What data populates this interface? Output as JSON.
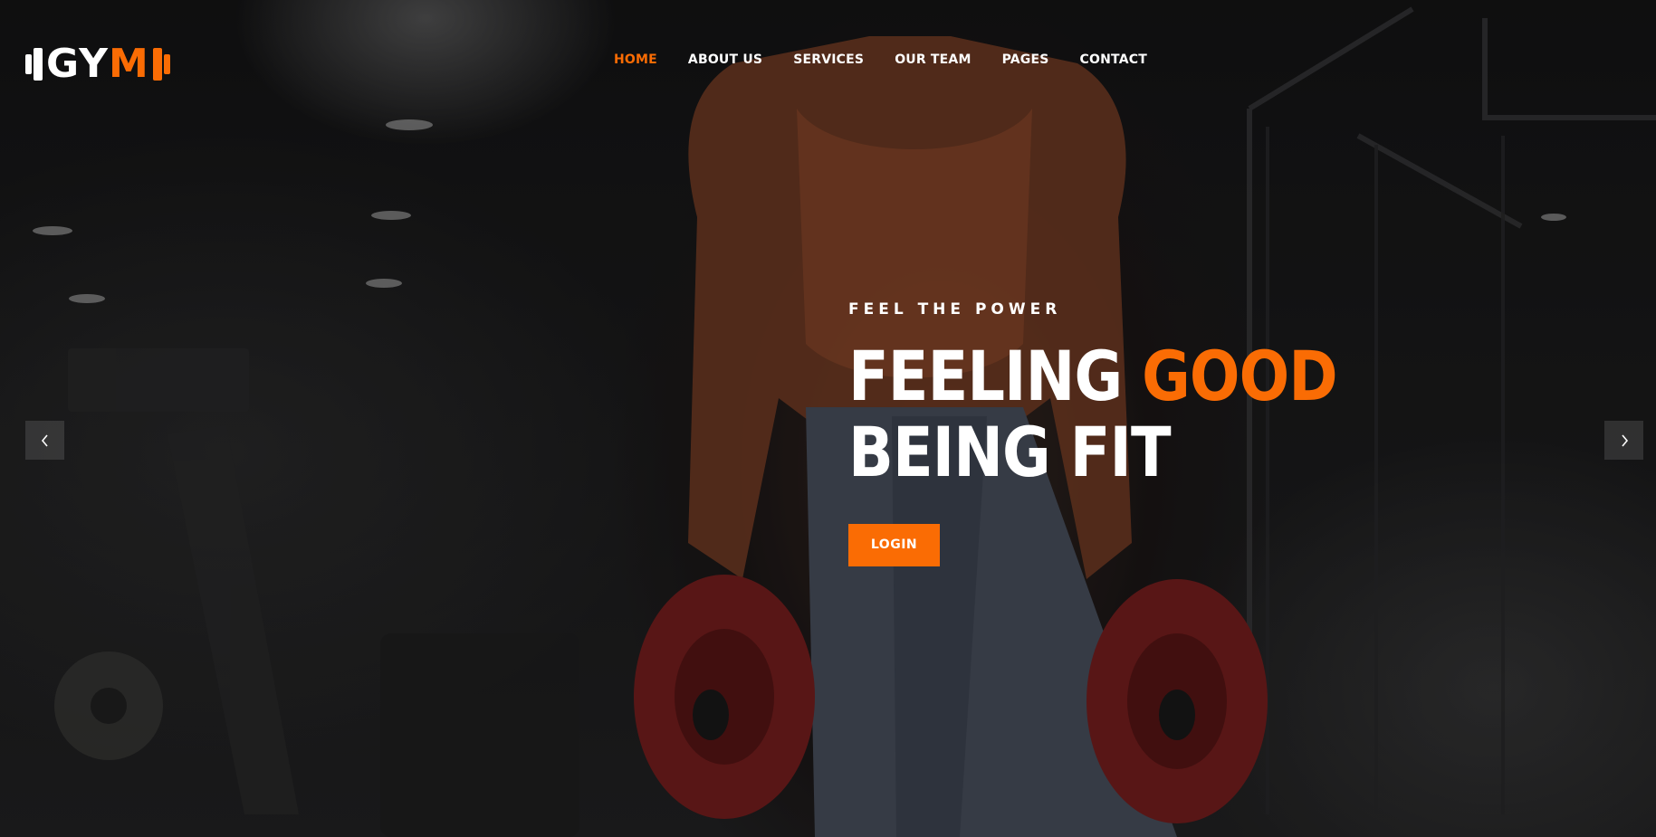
{
  "brand": {
    "logo_left": "G",
    "logo_right": "M",
    "accent_color": "#fa6c04"
  },
  "nav": {
    "items": [
      {
        "label": "HOME",
        "active": true
      },
      {
        "label": "ABOUT US",
        "active": false
      },
      {
        "label": "SERVICES",
        "active": false
      },
      {
        "label": "OUR TEAM",
        "active": false
      },
      {
        "label": "PAGES",
        "active": false
      },
      {
        "label": "CONTACT",
        "active": false
      }
    ]
  },
  "hero": {
    "eyebrow": "FEEL THE POWER",
    "headline_part1": "FEELING ",
    "headline_accent": "GOOD",
    "headline_line2": "BEING FIT",
    "cta_label": "LOGIN",
    "background_subject": "muscular man holding red weight plates in a dark gym"
  },
  "slider": {
    "prev_icon": "chevron-left-icon",
    "next_icon": "chevron-right-icon"
  }
}
